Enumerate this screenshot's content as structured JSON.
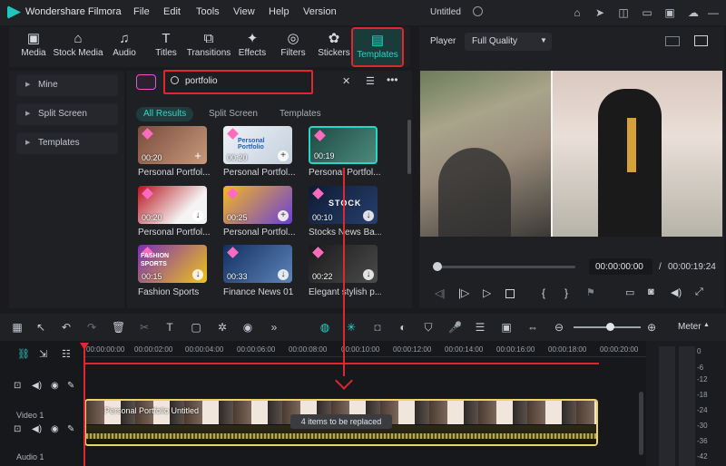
{
  "app": {
    "name": "Wondershare Filmora",
    "project": "Untitled"
  },
  "menu": [
    "File",
    "Edit",
    "Tools",
    "View",
    "Help",
    "Version"
  ],
  "toolbar": [
    {
      "label": "Media",
      "icon": "media-icon"
    },
    {
      "label": "Stock Media",
      "icon": "stock-media-icon"
    },
    {
      "label": "Audio",
      "icon": "audio-icon"
    },
    {
      "label": "Titles",
      "icon": "titles-icon"
    },
    {
      "label": "Transitions",
      "icon": "transitions-icon"
    },
    {
      "label": "Effects",
      "icon": "effects-icon"
    },
    {
      "label": "Filters",
      "icon": "filters-icon"
    },
    {
      "label": "Stickers",
      "icon": "stickers-icon"
    },
    {
      "label": "Templates",
      "icon": "templates-icon",
      "active": true
    }
  ],
  "sidebar": {
    "items": [
      "Mine",
      "Split Screen",
      "Templates"
    ]
  },
  "search": {
    "value": "portfolio"
  },
  "chips": [
    "All Results",
    "Split Screen",
    "Templates"
  ],
  "templates": [
    {
      "caption": "Personal Portfol...",
      "duration": "00:20",
      "color": "#8a5a4a"
    },
    {
      "caption": "Personal Portfol...",
      "duration": "00:20",
      "color": "#dfe6ee"
    },
    {
      "caption": "Personal Portfol...",
      "duration": "00:19",
      "color": "#2d5c53"
    },
    {
      "caption": "Personal Portfol...",
      "duration": "00:20",
      "color": "#c8202a"
    },
    {
      "caption": "Personal Portfol...",
      "duration": "00:25",
      "color": "#f0b429"
    },
    {
      "caption": "Stocks News Ba...",
      "duration": "00:10",
      "color": "#12203a"
    },
    {
      "caption": "Fashion Sports",
      "duration": "00:15",
      "color": "#7a2fb5"
    },
    {
      "caption": "Finance News 01",
      "duration": "00:33",
      "color": "#1d3f72"
    },
    {
      "caption": "Elegant stylish p...",
      "duration": "00:22",
      "color": "#2a2a2a"
    }
  ],
  "template_texts": [
    "FASHION SPORTS",
    "STOCK",
    "Personal Portfolio"
  ],
  "player": {
    "label": "Player",
    "quality": "Full Quality",
    "current_time": "00:00:00:00",
    "separator": "/",
    "total_time": "00:00:19:24"
  },
  "ruler": [
    "00:00:00:00",
    "00:00:02:00",
    "00:00:04:00",
    "00:00:06:00",
    "00:00:08:00",
    "00:00:10:00",
    "00:00:12:00",
    "00:00:14:00",
    "00:00:16:00",
    "00:00:18:00",
    "00:00:20:00"
  ],
  "tracks": {
    "video": "Video 1",
    "audio": "Audio 1"
  },
  "clip": {
    "title": "Personal Portfolio Untitled",
    "badge": "4 items to be replaced"
  },
  "meter": {
    "label": "Meter",
    "scale": [
      "0",
      "-6",
      "-12",
      "-18",
      "-24",
      "-30",
      "-36",
      "-42"
    ]
  },
  "colors": {
    "accent": "#26d6c8",
    "highlight": "#e0262e",
    "clip": "#e9d36a"
  }
}
